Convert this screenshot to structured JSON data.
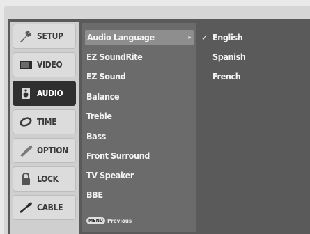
{
  "categories": [
    {
      "label": "SETUP",
      "icon": "wrench-icon",
      "active": false
    },
    {
      "label": "VIDEO",
      "icon": "tv-icon",
      "active": false
    },
    {
      "label": "AUDIO",
      "icon": "speaker-icon",
      "active": true
    },
    {
      "label": "TIME",
      "icon": "clock-icon",
      "active": false
    },
    {
      "label": "OPTION",
      "icon": "option-icon",
      "active": false
    },
    {
      "label": "LOCK",
      "icon": "lock-icon",
      "active": false
    },
    {
      "label": "CABLE",
      "icon": "cable-icon",
      "active": false
    }
  ],
  "submenu": {
    "items": [
      "Audio Language",
      "EZ SoundRite",
      "EZ Sound",
      "Balance",
      "Treble",
      "Bass",
      "Front Surround",
      "TV Speaker",
      "BBE"
    ],
    "selected_index": 0,
    "arrow": "▸"
  },
  "options": {
    "items": [
      "English",
      "Spanish",
      "French"
    ],
    "checked": "✓"
  },
  "hint": {
    "key": "MENU",
    "label": "Previous"
  }
}
